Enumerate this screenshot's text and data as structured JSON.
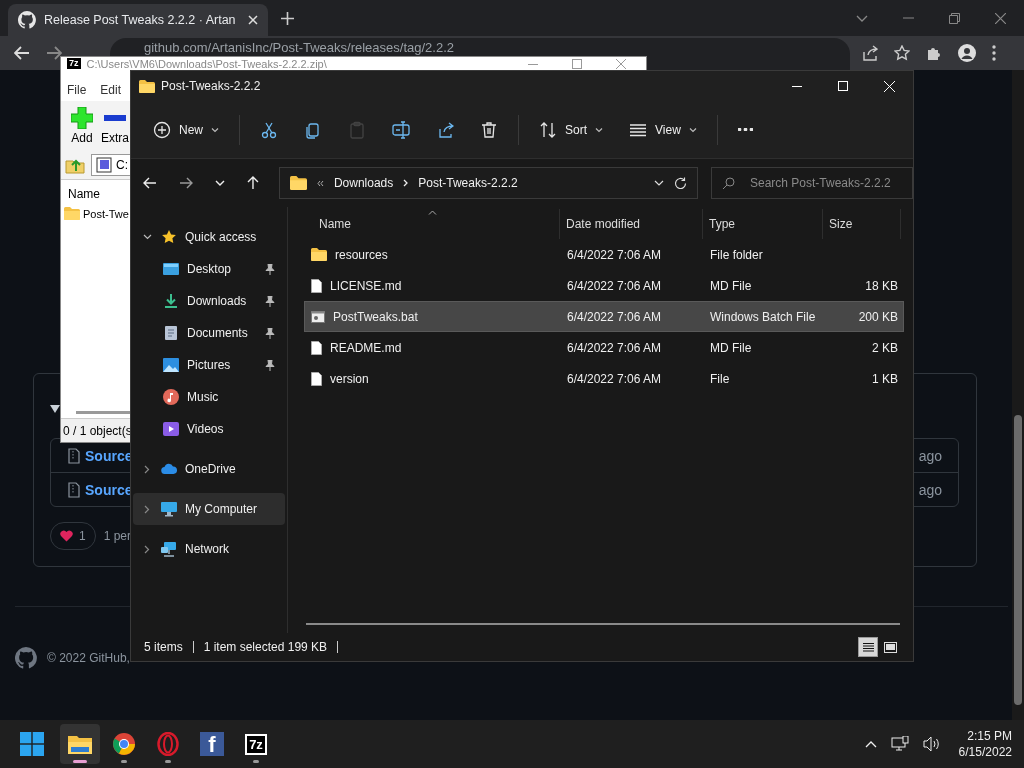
{
  "browser": {
    "tab_title": "Release Post Tweaks 2.2.2 · Artan",
    "url": "github.com/ArtanisInc/Post-Tweaks/releases/tag/2.2.2"
  },
  "page": {
    "assets": [
      {
        "label": "Source",
        "time": "ago"
      },
      {
        "label": "Source",
        "time": "ago"
      }
    ],
    "reaction_count": "1",
    "reaction_text": "1 per",
    "footer": "© 2022 GitHub,"
  },
  "archiver": {
    "logo": "7z",
    "title": "C:\\Users\\VM6\\Downloads\\Post-Tweaks-2.2.2.zip\\",
    "menu": [
      "File",
      "Edit"
    ],
    "tools": [
      "Add",
      "Extra"
    ],
    "path": "C:",
    "column": "Name",
    "items": [
      "Post-Twe"
    ],
    "status": "0 / 1 object(s"
  },
  "explorer": {
    "title": "Post-Tweaks-2.2.2",
    "toolbar": [
      {
        "kind": "new",
        "label": "New",
        "disabled": false
      },
      {
        "kind": "cut",
        "disabled": false
      },
      {
        "kind": "copy",
        "disabled": false
      },
      {
        "kind": "paste",
        "disabled": true
      },
      {
        "kind": "rename",
        "disabled": false
      },
      {
        "kind": "share",
        "disabled": false
      },
      {
        "kind": "delete",
        "disabled": false
      },
      {
        "kind": "sort",
        "label": "Sort",
        "disabled": false
      },
      {
        "kind": "view",
        "label": "View",
        "disabled": false
      },
      {
        "kind": "more",
        "disabled": false
      }
    ],
    "breadcrumbs": [
      "Downloads",
      "Post-Tweaks-2.2.2"
    ],
    "search": {
      "placeholder": "Search Post-Tweaks-2.2.2"
    },
    "nav": [
      {
        "label": "Quick access",
        "kind": "star",
        "expanded": true,
        "selected": false,
        "children": [
          {
            "label": "Desktop",
            "kind": "desktop",
            "pinned": true,
            "selected": false
          },
          {
            "label": "Downloads",
            "kind": "download",
            "pinned": true,
            "selected": false
          },
          {
            "label": "Documents",
            "kind": "document",
            "pinned": true,
            "selected": false
          },
          {
            "label": "Pictures",
            "kind": "picture",
            "pinned": true,
            "selected": false
          },
          {
            "label": "Music",
            "kind": "music",
            "pinned": false,
            "selected": false
          },
          {
            "label": "Videos",
            "kind": "video",
            "pinned": false,
            "selected": false
          }
        ]
      },
      {
        "label": "OneDrive",
        "kind": "cloud",
        "expanded": false,
        "selected": false
      },
      {
        "label": "My Computer",
        "kind": "computer",
        "expanded": false,
        "selected": true
      },
      {
        "label": "Network",
        "kind": "network",
        "expanded": false,
        "selected": false
      }
    ],
    "columns": [
      {
        "label": "Name",
        "sorted": true
      },
      {
        "label": "Date modified",
        "sorted": false
      },
      {
        "label": "Type",
        "sorted": false
      },
      {
        "label": "Size",
        "sorted": false
      }
    ],
    "files": [
      {
        "name": "resources",
        "kind": "folder",
        "date": "6/4/2022 7:06 AM",
        "type": "File folder",
        "selected": false
      },
      {
        "name": "LICENSE.md",
        "kind": "file",
        "date": "6/4/2022 7:06 AM",
        "type": "MD File",
        "size": "18 KB",
        "selected": false
      },
      {
        "name": "PostTweaks.bat",
        "kind": "batch",
        "date": "6/4/2022 7:06 AM",
        "type": "Windows Batch File",
        "size": "200 KB",
        "selected": true
      },
      {
        "name": "README.md",
        "kind": "file",
        "date": "6/4/2022 7:06 AM",
        "type": "MD File",
        "size": "2 KB",
        "selected": false
      },
      {
        "name": "version",
        "kind": "file",
        "date": "6/4/2022 7:06 AM",
        "type": "File",
        "size": "1 KB",
        "selected": false
      }
    ],
    "status": [
      "5 items",
      "1 item selected  199 KB"
    ],
    "view_modes": [
      {
        "kind": "details",
        "selected": true
      },
      {
        "kind": "tiles",
        "selected": false
      }
    ]
  },
  "taskbar": {
    "apps": [
      {
        "kind": "explorer",
        "selected": true,
        "running": true
      },
      {
        "kind": "chrome",
        "selected": false,
        "running": true
      },
      {
        "kind": "opera",
        "selected": false,
        "running": true
      },
      {
        "kind": "facebook",
        "glyph": "f",
        "selected": false,
        "running": false
      },
      {
        "kind": "sevenzip",
        "glyph": "7z",
        "selected": false,
        "running": true
      }
    ],
    "time": "2:15 PM",
    "date": "6/15/2022"
  }
}
